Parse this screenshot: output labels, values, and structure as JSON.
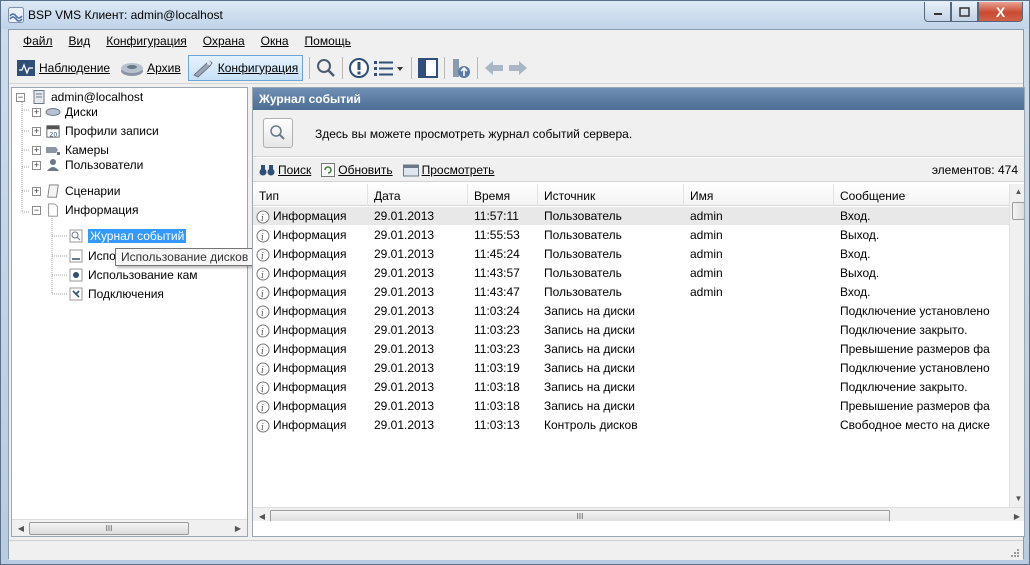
{
  "window": {
    "title": "BSP VMS Клиент: admin@localhost",
    "close_glyph": "X"
  },
  "menu": [
    "Файл",
    "Вид",
    "Конфигурация",
    "Охрана",
    "Окна",
    "Помощь"
  ],
  "toolbar": {
    "monitoring": "Наблюдение",
    "archive": "Архив",
    "configuration": "Конфигурация"
  },
  "tree": {
    "root": "admin@localhost",
    "disks": "Диски",
    "profiles": "Профили записи",
    "cameras": "Камеры",
    "users": "Пользователи",
    "scenarios": "Сценарии",
    "info": "Информация",
    "event_log": "Журнал событий",
    "disk_usage": "Использование дисков",
    "camera_usage": "Использование кам",
    "connections": "Подключения",
    "tooltip": "Использование дисков",
    "hscroll_grip": "III"
  },
  "panel": {
    "header": "Журнал событий",
    "description": "Здесь вы можете просмотреть журнал событий сервера.",
    "search": "Поиск",
    "refresh": "Обновить",
    "view": "Просмотреть",
    "count": "элементов: 474"
  },
  "grid": {
    "columns": [
      "Тип",
      "Дата",
      "Время",
      "Источник",
      "Имя",
      "Сообщение"
    ],
    "rows": [
      [
        "Информация",
        "29.01.2013",
        "11:57:11",
        "Пользователь",
        "admin",
        "Вход."
      ],
      [
        "Информация",
        "29.01.2013",
        "11:55:53",
        "Пользователь",
        "admin",
        "Выход."
      ],
      [
        "Информация",
        "29.01.2013",
        "11:45:24",
        "Пользователь",
        "admin",
        "Вход."
      ],
      [
        "Информация",
        "29.01.2013",
        "11:43:57",
        "Пользователь",
        "admin",
        "Выход."
      ],
      [
        "Информация",
        "29.01.2013",
        "11:43:47",
        "Пользователь",
        "admin",
        "Вход."
      ],
      [
        "Информация",
        "29.01.2013",
        "11:03:24",
        "Запись на диски",
        "",
        "Подключение установлено"
      ],
      [
        "Информация",
        "29.01.2013",
        "11:03:23",
        "Запись на диски",
        "",
        "Подключение закрыто."
      ],
      [
        "Информация",
        "29.01.2013",
        "11:03:23",
        "Запись на диски",
        "",
        "Превышение размеров фа"
      ],
      [
        "Информация",
        "29.01.2013",
        "11:03:19",
        "Запись на диски",
        "",
        "Подключение установлено"
      ],
      [
        "Информация",
        "29.01.2013",
        "11:03:18",
        "Запись на диски",
        "",
        "Подключение закрыто."
      ],
      [
        "Информация",
        "29.01.2013",
        "11:03:18",
        "Запись на диски",
        "",
        "Превышение размеров фа"
      ],
      [
        "Информация",
        "29.01.2013",
        "11:03:13",
        "Контроль дисков",
        "",
        "Свободное место на диске"
      ]
    ],
    "hscroll_grip": "III"
  }
}
